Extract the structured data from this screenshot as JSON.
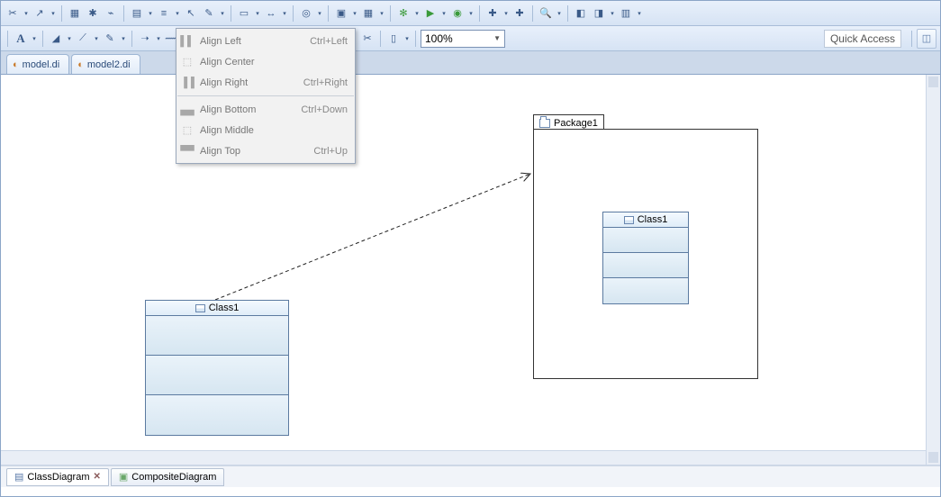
{
  "toolbar": {
    "zoom_value": "100%"
  },
  "quick_access_placeholder": "Quick Access",
  "editor_tabs": [
    {
      "label": "model.di"
    },
    {
      "label": "model2.di"
    }
  ],
  "context_menu": {
    "groups": [
      [
        {
          "label": "Align Left",
          "shortcut": "Ctrl+Left"
        },
        {
          "label": "Align Center",
          "shortcut": ""
        },
        {
          "label": "Align Right",
          "shortcut": "Ctrl+Right"
        }
      ],
      [
        {
          "label": "Align Bottom",
          "shortcut": "Ctrl+Down"
        },
        {
          "label": "Align Middle",
          "shortcut": ""
        },
        {
          "label": "Align Top",
          "shortcut": "Ctrl+Up"
        }
      ]
    ]
  },
  "diagram": {
    "class_left": {
      "name": "Class1"
    },
    "package": {
      "name": "Package1"
    },
    "class_inside": {
      "name": "Class1"
    }
  },
  "bottom_tabs": [
    {
      "label": "ClassDiagram",
      "closeable": true
    },
    {
      "label": "CompositeDiagram",
      "closeable": false
    }
  ]
}
